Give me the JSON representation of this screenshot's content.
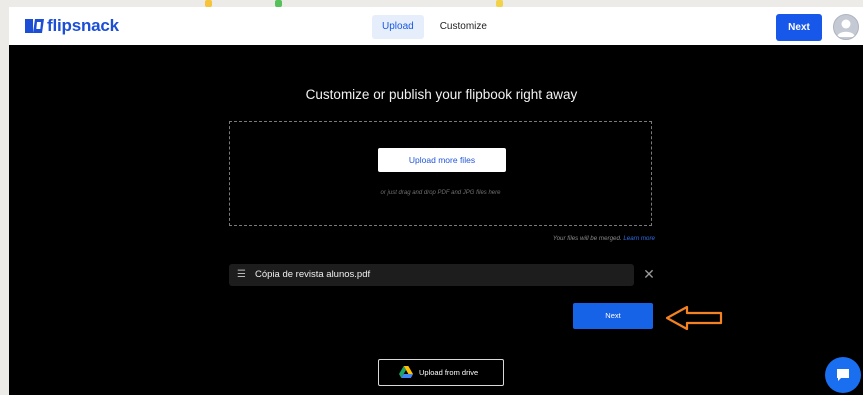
{
  "header": {
    "logo_text": "flipsnack",
    "tabs": [
      {
        "label": "Upload",
        "active": true
      },
      {
        "label": "Customize",
        "active": false
      }
    ],
    "next_label": "Next"
  },
  "main": {
    "headline": "Customize or publish your flipbook right away",
    "upload_more_label": "Upload more files",
    "drag_hint": "or just drag and drop PDF and JPG files here",
    "merge_note": "Your files will be merged.",
    "learn_more": "Learn more",
    "file_name": "Cópia de revista alunos.pdf",
    "next_label": "Next",
    "drive_label": "Upload from drive"
  },
  "icons": {
    "logo": "flipsnack-logo-icon",
    "avatar": "user-avatar-icon",
    "drag": "drag-handle-icon",
    "remove": "close-icon",
    "arrow": "arrow-left-icon",
    "drive": "google-drive-icon",
    "chat": "chat-icon"
  },
  "colors": {
    "accent": "#1757ea",
    "panel_bg": "#000000",
    "arrow_annotation": "#f58220"
  }
}
